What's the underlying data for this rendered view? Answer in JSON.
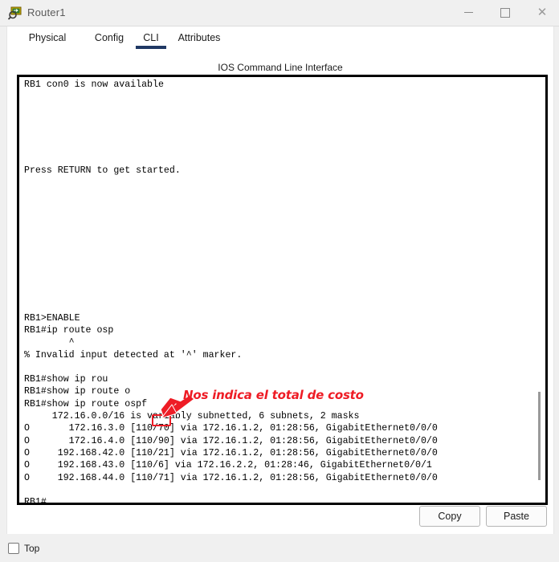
{
  "window": {
    "title": "Router1",
    "icon": "router-magnifier-icon",
    "controls": {
      "minimize": "minimize-icon",
      "maximize": "maximize-icon",
      "close": "close-icon"
    }
  },
  "tabs": [
    {
      "label": "Physical",
      "active": false
    },
    {
      "label": "Config",
      "active": false
    },
    {
      "label": "CLI",
      "active": true
    },
    {
      "label": "Attributes",
      "active": false
    }
  ],
  "cli": {
    "header": "IOS Command Line Interface",
    "text": "RB1 con0 is now available\n\n\n\n\n\n\nPress RETURN to get started.\n\n\n\n\n\n\n\n\n\n\n\nRB1>ENABLE\nRB1#ip route osp\n        ^\n% Invalid input detected at '^' marker.\n\nRB1#show ip rou\nRB1#show ip route o\nRB1#show ip route ospf\n     172.16.0.0/16 is variably subnetted, 6 subnets, 2 masks\nO       172.16.3.0 [110/70] via 172.16.1.2, 01:28:56, GigabitEthernet0/0/0\nO       172.16.4.0 [110/90] via 172.16.1.2, 01:28:56, GigabitEthernet0/0/0\nO     192.168.42.0 [110/21] via 172.16.1.2, 01:28:56, GigabitEthernet0/0/0\nO     192.168.43.0 [110/6] via 172.16.2.2, 01:28:46, GigabitEthernet0/0/1\nO     192.168.44.0 [110/71] via 172.16.1.2, 01:28:56, GigabitEthernet0/0/0\n\nRB1#",
    "routes": [
      {
        "code": "O",
        "network": "172.16.3.0",
        "metric": "[110/70]",
        "via": "172.16.1.2",
        "age": "01:28:56",
        "interface": "GigabitEthernet0/0/0"
      },
      {
        "code": "O",
        "network": "172.16.4.0",
        "metric": "[110/90]",
        "via": "172.16.1.2",
        "age": "01:28:56",
        "interface": "GigabitEthernet0/0/0"
      },
      {
        "code": "O",
        "network": "192.168.42.0",
        "metric": "[110/21]",
        "via": "172.16.1.2",
        "age": "01:28:56",
        "interface": "GigabitEthernet0/0/0"
      },
      {
        "code": "O",
        "network": "192.168.43.0",
        "metric": "[110/6]",
        "via": "172.16.2.2",
        "age": "01:28:46",
        "interface": "GigabitEthernet0/0/1"
      },
      {
        "code": "O",
        "network": "192.168.44.0",
        "metric": "[110/71]",
        "via": "172.16.1.2",
        "age": "01:28:56",
        "interface": "GigabitEthernet0/0/0"
      }
    ],
    "prompt": "RB1#"
  },
  "annotation": {
    "text": "Nos indica el total de costo",
    "highlight_value": "70",
    "color": "#ee1c25",
    "outline_color": "#ffffff"
  },
  "buttons": {
    "copy": "Copy",
    "paste": "Paste"
  },
  "footer": {
    "top_checkbox_label": "Top",
    "top_checked": false
  }
}
